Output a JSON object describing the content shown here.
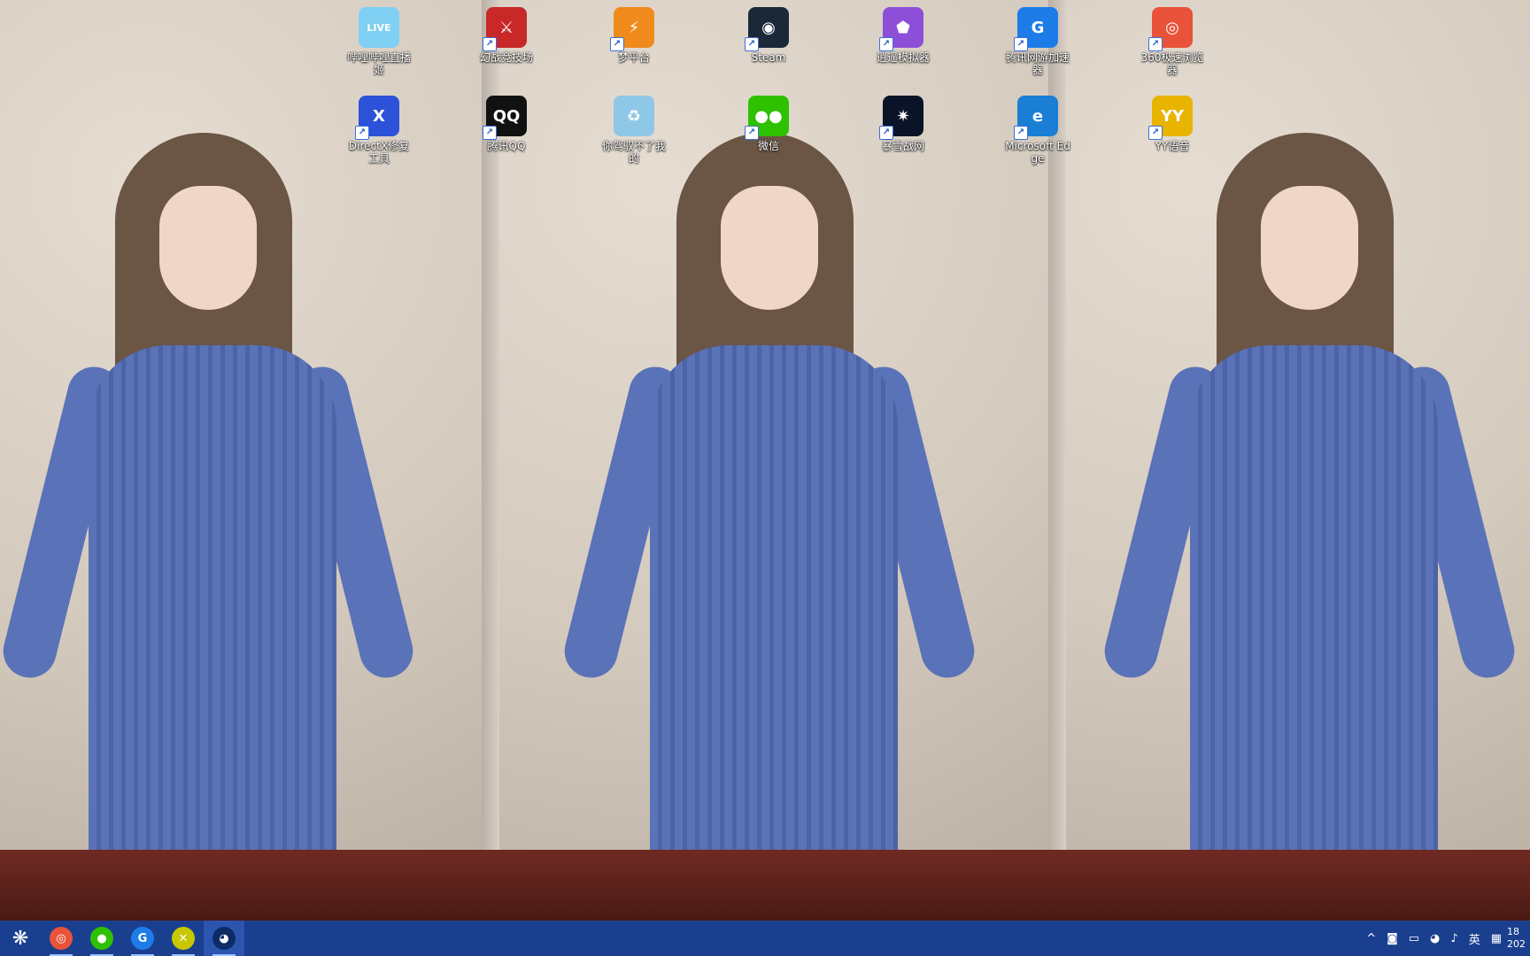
{
  "desktop": {
    "icons_row1": [
      {
        "label": "哔哩哔哩直播姬",
        "icon": "bilibili-live-icon",
        "color": "#7fd0f3",
        "glyph": "LIVE",
        "shortcut": false
      },
      {
        "label": "幻战竞技场",
        "icon": "arena-game-icon",
        "color": "#c82828",
        "glyph": "⚔",
        "shortcut": true
      },
      {
        "label": "梦平台",
        "icon": "dream-platform-icon",
        "color": "#f08a1c",
        "glyph": "⚡",
        "shortcut": true
      },
      {
        "label": "Steam",
        "icon": "steam-icon",
        "color": "#1b2838",
        "glyph": "◉",
        "shortcut": true
      },
      {
        "label": "逍遥模拟器",
        "icon": "xiaoyao-emulator-icon",
        "color": "#8d4fd8",
        "glyph": "⬟",
        "shortcut": true
      },
      {
        "label": "腾讯网游加速器",
        "icon": "tencent-accelerator-icon",
        "color": "#1d7ce8",
        "glyph": "G",
        "shortcut": true
      },
      {
        "label": "360极速浏览器",
        "icon": "360-browser-icon",
        "color": "#e8533a",
        "glyph": "◎",
        "shortcut": true
      }
    ],
    "icons_row2": [
      {
        "label": "DirectX修复工具",
        "icon": "directx-repair-icon",
        "color": "#2b52d8",
        "glyph": "X",
        "shortcut": true
      },
      {
        "label": "腾讯QQ",
        "icon": "qq-icon",
        "color": "#111111",
        "glyph": "QQ",
        "shortcut": true
      },
      {
        "label": "你驾驭不了我的",
        "icon": "recycle-bin-icon",
        "color": "#8fc7e6",
        "glyph": "♻",
        "shortcut": false
      },
      {
        "label": "微信",
        "icon": "wechat-icon",
        "color": "#2dc100",
        "glyph": "●●",
        "shortcut": true
      },
      {
        "label": "暴雪战网",
        "icon": "battlenet-icon",
        "color": "#0a1428",
        "glyph": "✷",
        "shortcut": true
      },
      {
        "label": "Microsoft Edge",
        "icon": "edge-icon",
        "color": "#1a7fd4",
        "glyph": "e",
        "shortcut": true
      },
      {
        "label": "YY语音",
        "icon": "yy-voice-icon",
        "color": "#e8b400",
        "glyph": "YY",
        "shortcut": true
      }
    ]
  },
  "taskbar": {
    "buttons": [
      {
        "icon": "start-icon",
        "glyph": "❋",
        "color": "#1b3f8f"
      },
      {
        "icon": "360-browser-icon",
        "glyph": "◎",
        "color": "#e8533a"
      },
      {
        "icon": "wechat-icon",
        "glyph": "●",
        "color": "#2dc100"
      },
      {
        "icon": "tencent-accelerator-icon",
        "glyph": "G",
        "color": "#1d7ce8"
      },
      {
        "icon": "yellow-app-icon",
        "glyph": "✕",
        "color": "#c8c800"
      },
      {
        "icon": "qq-app-icon",
        "glyph": "◕",
        "color": "#0d2c66"
      }
    ],
    "tray": {
      "chevron": "^",
      "ime_label": "英",
      "clock_time": "18",
      "clock_date": "202"
    }
  },
  "colors": {
    "taskbar": "#1b3f8f",
    "dress": "#5a72b8"
  }
}
